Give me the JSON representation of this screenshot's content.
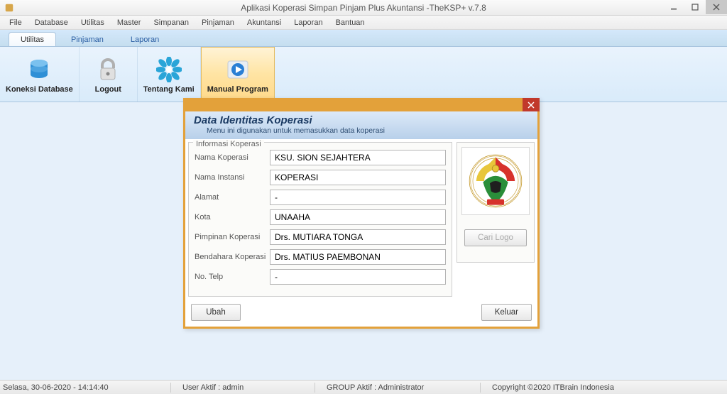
{
  "app": {
    "title": "Aplikasi Koperasi Simpan Pinjam Plus Akuntansi -TheKSP+  v.7.8"
  },
  "menu": [
    "File",
    "Database",
    "Utilitas",
    "Master",
    "Simpanan",
    "Pinjaman",
    "Akuntansi",
    "Laporan",
    "Bantuan"
  ],
  "tabs": [
    "Utilitas",
    "Pinjaman",
    "Laporan"
  ],
  "ribbon": {
    "koneksi": "Koneksi Database",
    "logout": "Logout",
    "tentang": "Tentang Kami",
    "manual": "Manual Program"
  },
  "dialog": {
    "title": "Data Identitas Koperasi",
    "subtitle": "Menu ini digunakan untuk memasukkan data koperasi",
    "group": "Informasi Koperasi",
    "labels": {
      "nama_koperasi": "Nama Koperasi",
      "nama_instansi": "Nama Instansi",
      "alamat": "Alamat",
      "kota": "Kota",
      "pimpinan": "Pimpinan Koperasi",
      "bendahara": "Bendahara Koperasi",
      "no_telp": "No. Telp"
    },
    "values": {
      "nama_koperasi": "KSU. SION SEJAHTERA",
      "nama_instansi": "KOPERASI",
      "alamat": "-",
      "kota": "UNAAHA",
      "pimpinan": "Drs. MUTIARA TONGA",
      "bendahara": "Drs. MATIUS PAEMBONAN",
      "no_telp": "-"
    },
    "buttons": {
      "cari_logo": "Cari Logo",
      "ubah": "Ubah",
      "keluar": "Keluar"
    }
  },
  "status": {
    "datetime": "Selasa, 30-06-2020 - 14:14:40",
    "user": "User Aktif  : admin",
    "group": "GROUP Aktif  : Administrator",
    "copyright": "Copyright ©2020 ITBrain Indonesia"
  }
}
